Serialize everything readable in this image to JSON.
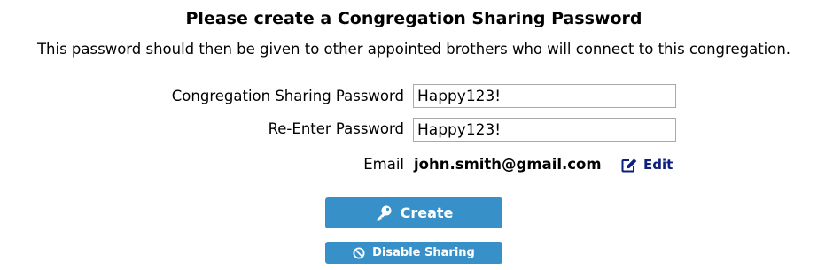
{
  "header": {
    "title": "Please create a Congregation Sharing Password",
    "subtitle": "This password should then be given to other appointed brothers who will connect to this congregation."
  },
  "form": {
    "password_label": "Congregation Sharing Password",
    "password_value": "Happy123!",
    "reenter_label": "Re-Enter Password",
    "reenter_value": "Happy123!",
    "email_label": "Email",
    "email_value": "john.smith@gmail.com",
    "edit_label": "Edit",
    "edit_icon": "edit-icon"
  },
  "actions": {
    "create_label": "Create",
    "create_icon": "key-icon",
    "disable_label": "Disable Sharing",
    "disable_icon": "ban-icon"
  },
  "colors": {
    "button_bg": "#3890c9",
    "link": "#0b1f7d",
    "button_text": "#ffffff"
  }
}
